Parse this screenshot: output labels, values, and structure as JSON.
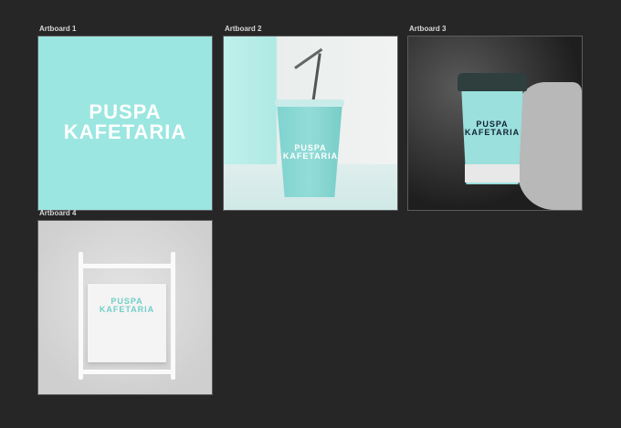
{
  "artboards": [
    {
      "label": "Artboard 1",
      "logo": [
        "PUSPA",
        "KAFETARIA"
      ]
    },
    {
      "label": "Artboard 2",
      "logo": [
        "PUSPA",
        "KAFETARIA"
      ]
    },
    {
      "label": "Artboard 3",
      "logo": [
        "PUSPA",
        "KAFETARIA"
      ]
    },
    {
      "label": "Artboard 4",
      "logo": [
        "PUSPA",
        "KAFETARIA"
      ]
    }
  ],
  "colors": {
    "canvas": "#262626",
    "brand_teal": "#9be6e0"
  }
}
